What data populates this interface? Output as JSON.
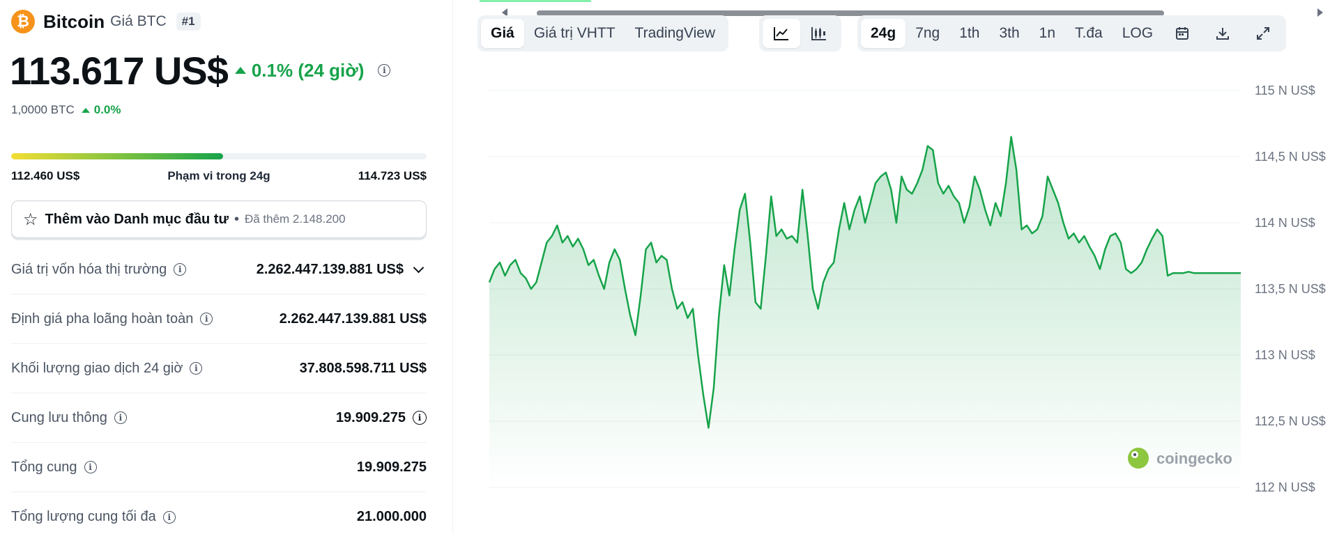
{
  "coin": {
    "logo_letter": "₿",
    "name": "Bitcoin",
    "ticker": "Giá BTC",
    "rank": "#1"
  },
  "price": {
    "value": "113.617 US$",
    "change": "0.1% (24 giờ)",
    "btc_value": "1,0000 BTC",
    "btc_change": "0.0%"
  },
  "range": {
    "low": "112.460 US$",
    "label": "Phạm vi trong 24g",
    "high": "114.723 US$",
    "fill_fraction": 0.51
  },
  "watchlist": {
    "label": "Thêm vào Danh mục đầu tư",
    "separator": "•",
    "count": "Đã thêm 2.148.200"
  },
  "stats": [
    {
      "label": "Giá trị vốn hóa thị trường",
      "value": "2.262.447.139.881 US$"
    },
    {
      "label": "Định giá pha loãng hoàn toàn",
      "value": "2.262.447.139.881 US$"
    },
    {
      "label": "Khối lượng giao dịch 24 giờ",
      "value": "37.808.598.711 US$"
    },
    {
      "label": "Cung lưu thông",
      "value": "19.909.275"
    },
    {
      "label": "Tổng cung",
      "value": "19.909.275"
    },
    {
      "label": "Tổng lượng cung tối đa",
      "value": "21.000.000"
    }
  ],
  "chart_tabs": {
    "view": [
      "Giá",
      "Giá trị VHTT",
      "TradingView"
    ],
    "range": [
      "24g",
      "7ng",
      "1th",
      "3th",
      "1n",
      "T.đa",
      "LOG"
    ]
  },
  "colors": {
    "accent_green": "#16a34a",
    "bitcoin_orange": "#f7931a"
  },
  "watermark": "coingecko",
  "chart_data": {
    "type": "area",
    "ylabel_unit": "N US$",
    "ylim": [
      112,
      115
    ],
    "yticks": [
      "112 N US$",
      "112,5 N US$",
      "113 N US$",
      "113,5 N US$",
      "114 N US$",
      "114,5 N US$",
      "115 N US$"
    ],
    "grid": true,
    "x": [
      0,
      1,
      2,
      3,
      4,
      5,
      6,
      7,
      8,
      9,
      10,
      11,
      12,
      13,
      14,
      15,
      16,
      17,
      18,
      19,
      20,
      21,
      22,
      23,
      24,
      25,
      26,
      27,
      28,
      29,
      30,
      31,
      32,
      33,
      34,
      35,
      36,
      37,
      38,
      39,
      40,
      41,
      42,
      43,
      44,
      45,
      46,
      47,
      48,
      49,
      50,
      51,
      52,
      53,
      54,
      55,
      56,
      57,
      58,
      59,
      60,
      61,
      62,
      63,
      64,
      65,
      66,
      67,
      68,
      69,
      70,
      71,
      72,
      73,
      74,
      75,
      76,
      77,
      78,
      79,
      80,
      81,
      82,
      83,
      84,
      85,
      86,
      87,
      88,
      89,
      90,
      91,
      92,
      93,
      94,
      95,
      96,
      97,
      98,
      99,
      100,
      101,
      102,
      103,
      104,
      105,
      106,
      107,
      108,
      109,
      110,
      111,
      112,
      113,
      114,
      115,
      116,
      117,
      118,
      119,
      120,
      121,
      122,
      123,
      124,
      125,
      126,
      127,
      128,
      129,
      130,
      131,
      132,
      133,
      134,
      135,
      136,
      137,
      138,
      139,
      140,
      141,
      142,
      143,
      144
    ],
    "values": [
      113.55,
      113.65,
      113.7,
      113.6,
      113.68,
      113.72,
      113.62,
      113.58,
      113.5,
      113.55,
      113.7,
      113.85,
      113.9,
      113.98,
      113.85,
      113.9,
      113.82,
      113.88,
      113.8,
      113.68,
      113.72,
      113.6,
      113.5,
      113.7,
      113.8,
      113.72,
      113.5,
      113.3,
      113.15,
      113.45,
      113.8,
      113.85,
      113.7,
      113.75,
      113.72,
      113.5,
      113.35,
      113.4,
      113.28,
      113.35,
      113.0,
      112.7,
      112.45,
      112.75,
      113.3,
      113.68,
      113.45,
      113.8,
      114.1,
      114.22,
      113.85,
      113.4,
      113.35,
      113.75,
      114.2,
      113.9,
      113.95,
      113.88,
      113.9,
      113.85,
      114.25,
      113.9,
      113.5,
      113.35,
      113.55,
      113.65,
      113.7,
      113.95,
      114.15,
      113.95,
      114.1,
      114.2,
      114.0,
      114.15,
      114.3,
      114.35,
      114.38,
      114.25,
      114.0,
      114.35,
      114.25,
      114.22,
      114.3,
      114.4,
      114.58,
      114.55,
      114.3,
      114.22,
      114.28,
      114.2,
      114.15,
      114.0,
      114.12,
      114.35,
      114.25,
      114.1,
      113.98,
      114.15,
      114.05,
      114.3,
      114.65,
      114.4,
      113.95,
      113.98,
      113.92,
      113.95,
      114.05,
      114.35,
      114.25,
      114.15,
      114.0,
      113.88,
      113.92,
      113.85,
      113.9,
      113.82,
      113.75,
      113.65,
      113.8,
      113.9,
      113.92,
      113.85,
      113.65,
      113.62,
      113.65,
      113.7,
      113.8,
      113.88,
      113.95,
      113.9,
      113.6,
      113.62,
      113.62,
      113.62,
      113.63,
      113.62,
      113.62,
      113.62,
      113.62,
      113.62,
      113.62,
      113.62,
      113.62,
      113.62,
      113.62
    ]
  }
}
